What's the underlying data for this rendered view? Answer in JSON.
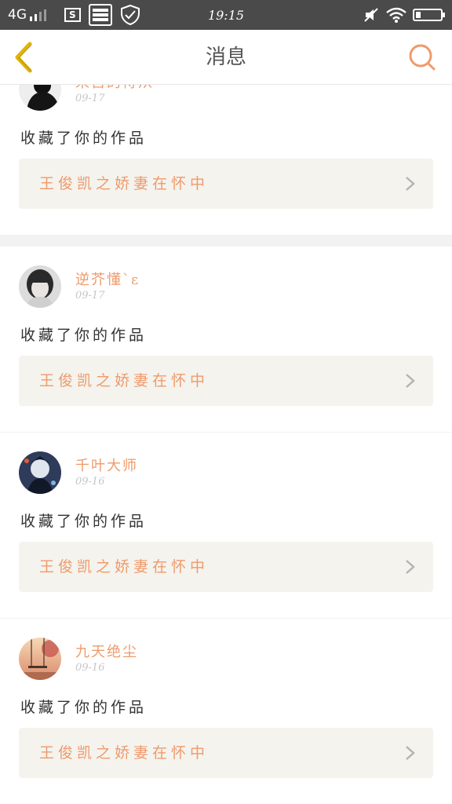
{
  "status_bar": {
    "network": "4G",
    "sim_label": "S",
    "time": "19:15"
  },
  "header": {
    "title": "消息"
  },
  "colors": {
    "accent": "#ef9a6b",
    "back_arrow": "#e3b400",
    "card_bg": "#ffffff",
    "work_bg": "#f4f3ee",
    "page_bg": "#f2f2f2"
  },
  "notifications": [
    {
      "user": "来自的侍从",
      "date": "09-17",
      "action": "收藏了你的作品",
      "work": "王俊凯之娇妻在怀中",
      "avatar": "avatar-dark-portrait"
    },
    {
      "user": "逆芥懂`ε",
      "date": "09-17",
      "action": "收藏了你的作品",
      "work": "王俊凯之娇妻在怀中",
      "avatar": "avatar-girl-portrait"
    },
    {
      "user": "千叶大师",
      "date": "09-16",
      "action": "收藏了你的作品",
      "work": "王俊凯之娇妻在怀中",
      "avatar": "avatar-anime"
    },
    {
      "user": "九天绝尘",
      "date": "09-16",
      "action": "收藏了你的作品",
      "work": "王俊凯之娇妻在怀中",
      "avatar": "avatar-sunset-swing"
    }
  ]
}
